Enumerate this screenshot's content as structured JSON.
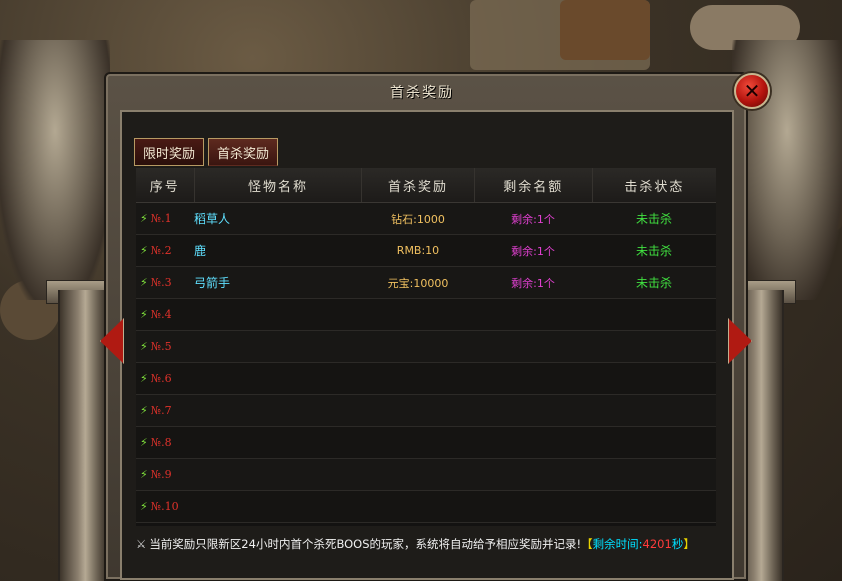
{
  "window": {
    "title": "首杀奖励",
    "close_icon": "close-icon"
  },
  "tabs": [
    {
      "label": "限时奖励",
      "active": false
    },
    {
      "label": "首杀奖励",
      "active": true
    }
  ],
  "table": {
    "headers": [
      "序号",
      "怪物名称",
      "首杀奖励",
      "剩余名额",
      "击杀状态"
    ],
    "rows": [
      {
        "index": "№.1",
        "name": "稻草人",
        "reward": "钻石:1000",
        "remain": "剩余:1个",
        "status": "未击杀"
      },
      {
        "index": "№.2",
        "name": "鹿",
        "reward": "RMB:10",
        "remain": "剩余:1个",
        "status": "未击杀"
      },
      {
        "index": "№.3",
        "name": "弓箭手",
        "reward": "元宝:10000",
        "remain": "剩余:1个",
        "status": "未击杀"
      },
      {
        "index": "№.4",
        "name": "",
        "reward": "",
        "remain": "",
        "status": ""
      },
      {
        "index": "№.5",
        "name": "",
        "reward": "",
        "remain": "",
        "status": ""
      },
      {
        "index": "№.6",
        "name": "",
        "reward": "",
        "remain": "",
        "status": ""
      },
      {
        "index": "№.7",
        "name": "",
        "reward": "",
        "remain": "",
        "status": ""
      },
      {
        "index": "№.8",
        "name": "",
        "reward": "",
        "remain": "",
        "status": ""
      },
      {
        "index": "№.9",
        "name": "",
        "reward": "",
        "remain": "",
        "status": ""
      },
      {
        "index": "№.10",
        "name": "",
        "reward": "",
        "remain": "",
        "status": ""
      }
    ]
  },
  "footer": {
    "notice": "当前奖励只限新区24小时内首个杀死BOOS的玩家，系统将自动给予相应奖励并记录!",
    "bracket_open": "【",
    "remaining_label": "剩余时间:",
    "remaining_value": "4201",
    "remaining_unit": "秒",
    "bracket_close": "】"
  },
  "icons": {
    "row_bolt": "lightning-icon",
    "footer_sword": "sword-icon",
    "nav_left": "arrow-left-icon",
    "nav_right": "arrow-right-icon"
  }
}
